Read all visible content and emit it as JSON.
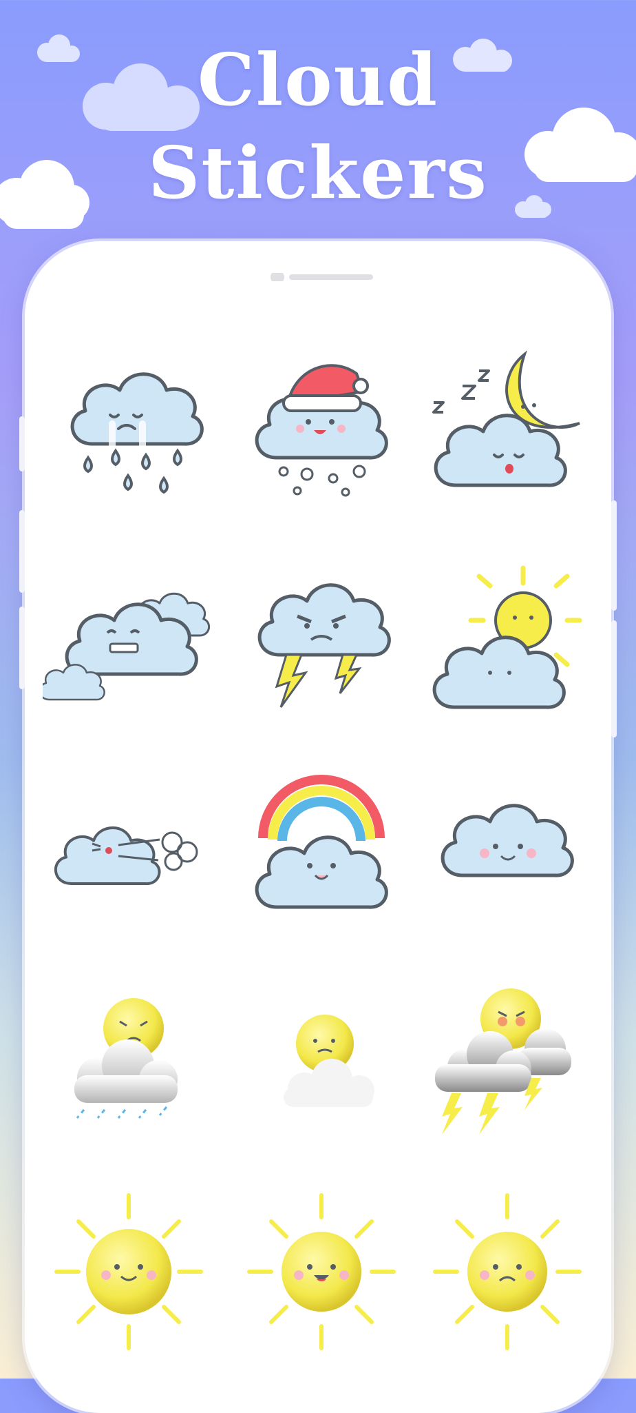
{
  "title": {
    "line1": "Cloud",
    "line2": "Stickers"
  },
  "stickers": [
    {
      "name": "crying-rain-cloud"
    },
    {
      "name": "santa-hat-snow-cloud"
    },
    {
      "name": "sleeping-moon-cloud"
    },
    {
      "name": "grimacing-cloud-pair"
    },
    {
      "name": "angry-thunder-cloud"
    },
    {
      "name": "sun-behind-cloud"
    },
    {
      "name": "blowing-wind-cloud"
    },
    {
      "name": "rainbow-cloud"
    },
    {
      "name": "smiling-cloud"
    },
    {
      "name": "sad-sun-rain-cloud"
    },
    {
      "name": "frowning-sun-fog-cloud"
    },
    {
      "name": "angry-sun-storm-cloud"
    },
    {
      "name": "smiling-sun"
    },
    {
      "name": "happy-sun"
    },
    {
      "name": "sad-sun"
    }
  ],
  "colors": {
    "cloud_fill": "#cfe6f7",
    "outline": "#555e66",
    "sun": "#f6ec4a",
    "background_top": "#8a9cfd",
    "background_bottom": "#fbf0d4"
  }
}
